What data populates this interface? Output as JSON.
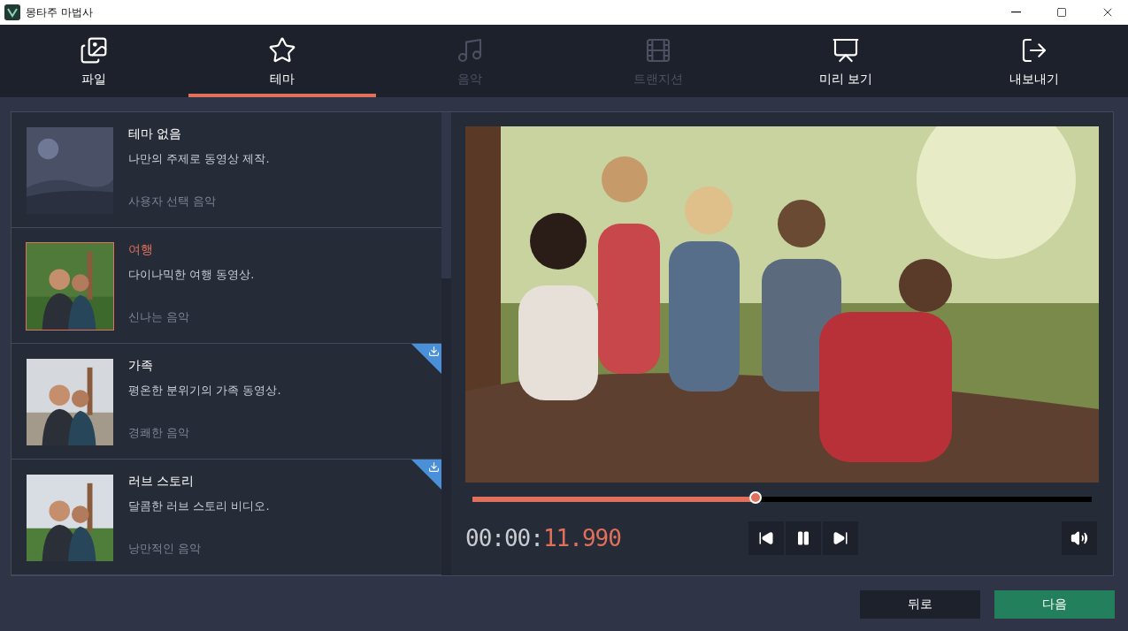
{
  "window": {
    "title": "몽타주 마법사"
  },
  "tabs": [
    {
      "label": "파일",
      "selected": false,
      "disabled": false
    },
    {
      "label": "테마",
      "selected": true,
      "disabled": false
    },
    {
      "label": "음악",
      "selected": false,
      "disabled": true
    },
    {
      "label": "트랜지션",
      "selected": false,
      "disabled": true
    },
    {
      "label": "미리 보기",
      "selected": false,
      "disabled": false
    },
    {
      "label": "내보내기",
      "selected": false,
      "disabled": false
    }
  ],
  "themes": [
    {
      "name": "테마 없음",
      "description": "나만의 주제로 동영상 제작.",
      "music": "사용자 선택 음악",
      "selected": false,
      "downloadable": false,
      "kind": "placeholder"
    },
    {
      "name": "여행",
      "description": "다이나믹한 여행 동영상.",
      "music": "신나는 음악",
      "selected": true,
      "downloadable": false
    },
    {
      "name": "가족",
      "description": "평온한 분위기의 가족 동영상.",
      "music": "경쾌한 음악",
      "selected": false,
      "downloadable": true
    },
    {
      "name": "러브 스토리",
      "description": "달콤한 러브 스토리 비디오.",
      "music": "낭만적인 음악",
      "selected": false,
      "downloadable": true
    }
  ],
  "player": {
    "level": 0.457,
    "time_elapsed": "00:00:",
    "time_fraction": "11.990"
  },
  "buttons": {
    "back": "뒤로",
    "next": "다음"
  }
}
